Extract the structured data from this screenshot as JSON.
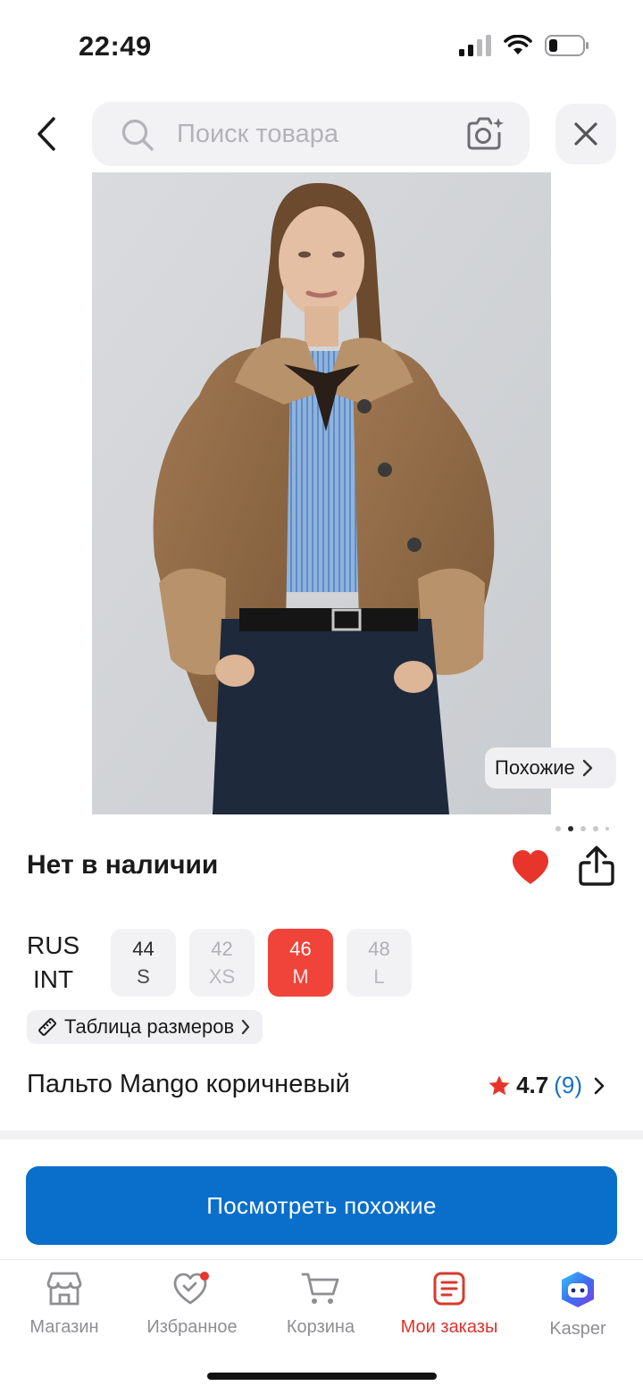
{
  "status_bar": {
    "time": "22:49"
  },
  "search": {
    "placeholder": "Поиск товара"
  },
  "product": {
    "similar_chip": "Похожие",
    "availability": "Нет в наличии",
    "size_system_top": "RUS",
    "size_system_bottom": "INT",
    "sizes": [
      {
        "rus": "44",
        "int": "S",
        "state": "available"
      },
      {
        "rus": "42",
        "int": "XS",
        "state": "unavailable"
      },
      {
        "rus": "46",
        "int": "M",
        "state": "selected"
      },
      {
        "rus": "48",
        "int": "L",
        "state": "unavailable"
      }
    ],
    "size_table_label": "Таблица размеров",
    "title": "Пальто Mango коричневый",
    "rating": "4.7",
    "reviews_count": "(9)",
    "image_dots": {
      "count": 5,
      "active_index": 1
    }
  },
  "cta": {
    "label": "Посмотреть похожие"
  },
  "bottom_nav": {
    "items": [
      {
        "label": "Магазин",
        "icon": "store-icon"
      },
      {
        "label": "Избранное",
        "icon": "heart-icon"
      },
      {
        "label": "Корзина",
        "icon": "cart-icon"
      },
      {
        "label": "Мои заказы",
        "icon": "orders-icon",
        "active": true
      },
      {
        "label": "Kasper",
        "icon": "kasper-icon"
      }
    ]
  },
  "colors": {
    "accent_red": "#f0443a",
    "cta_blue": "#0a6fcb",
    "link_blue": "#1a6fc4",
    "chip_bg": "#f2f2f4"
  }
}
